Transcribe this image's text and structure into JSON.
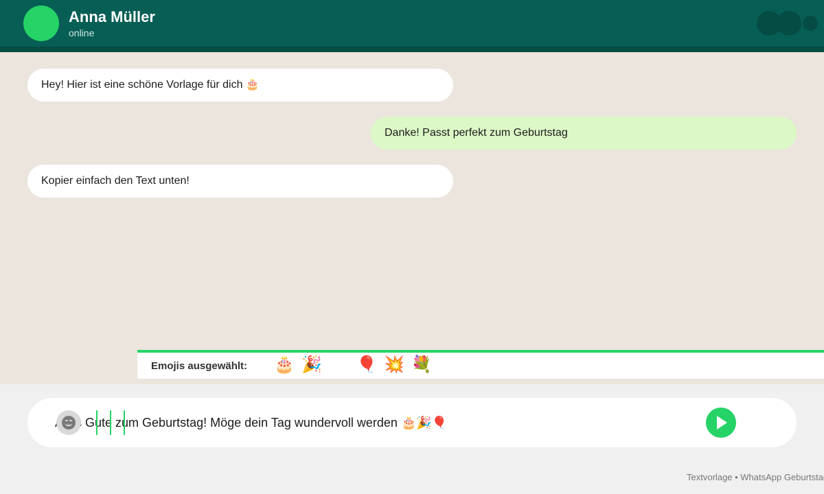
{
  "colors": {
    "header": "#075e54",
    "accent": "#25d366",
    "chat_background": "#ece5dd",
    "outgoing_bubble": "#dcf8c6",
    "incoming_bubble": "#ffffff"
  },
  "header": {
    "contact_name": "Anna Müller",
    "status": "online"
  },
  "messages": [
    {
      "direction": "incoming",
      "text": "Hey! Hier ist eine schöne Vorlage für dich 🎂"
    },
    {
      "direction": "outgoing",
      "text": "Danke! Passt perfekt zum Geburtstag"
    },
    {
      "direction": "incoming",
      "text": "Kopier einfach den Text unten!"
    }
  ],
  "emoji_picker": {
    "label": "Emojis ausgewählt:",
    "emojis": [
      "🎂",
      "🎉",
      "🎈",
      "💥",
      "💐"
    ]
  },
  "composer": {
    "value": "Alles Gute zum Geburtstag! Möge dein Tag wundervoll werden 🎂🎉🎈",
    "smiley_icon": "smiley-icon",
    "send_icon": "send-icon"
  },
  "footer": {
    "note": "Textvorlage • WhatsApp Geburtstag"
  }
}
